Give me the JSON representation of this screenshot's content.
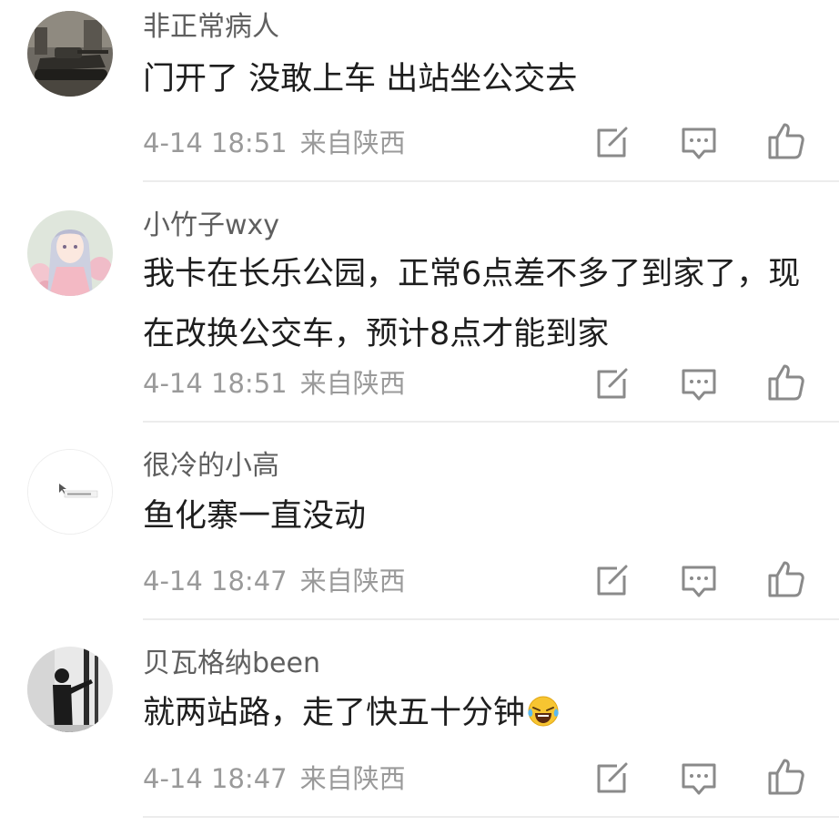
{
  "comments": [
    {
      "username": "非正常病人",
      "text": "门开了  没敢上车   出站坐公交去",
      "time": "4-14 18:51",
      "location": "来自陕西"
    },
    {
      "username": "小竹子wxy",
      "text": "我卡在长乐公园，正常6点差不多了到家了，现在改换公交车，预计8点才能到家",
      "time": "4-14 18:51",
      "location": "来自陕西"
    },
    {
      "username": "很冷的小高",
      "text": "鱼化寨一直没动",
      "time": "4-14 18:47",
      "location": "来自陕西"
    },
    {
      "username": "贝瓦格纳been",
      "text": "就两站路，走了快五十分钟",
      "time": "4-14 18:47",
      "location": "来自陕西"
    }
  ],
  "icons": {
    "repost": "share-edit-icon",
    "reply": "comment-bubble-icon",
    "like": "thumbs-up-icon",
    "emoji": "laughing-crying-emoji-icon"
  },
  "colors": {
    "username": "#5f5f5f",
    "text": "#1e1e1e",
    "meta": "#9a9a9a",
    "icon": "#8a8a8a",
    "divider": "#ececec"
  }
}
